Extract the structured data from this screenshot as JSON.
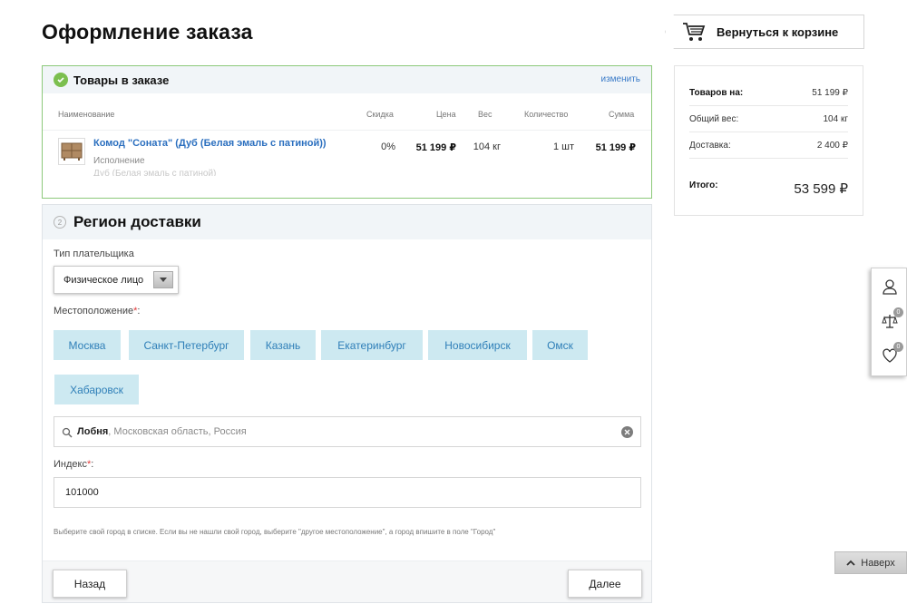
{
  "page": {
    "title": "Оформление заказа"
  },
  "header": {
    "back_to_cart_label": "Вернуться к корзине"
  },
  "goods": {
    "title": "Товары в заказе",
    "change_link": "изменить",
    "columns": {
      "name": "Наименование",
      "discount": "Скидка",
      "price": "Цена",
      "weight": "Вес",
      "quantity": "Количество",
      "sum": "Сумма"
    },
    "items": [
      {
        "name": "Комод \"Соната\" (Дуб (Белая эмаль с патиной))",
        "option_label": "Исполнение",
        "option_value": "Дуб (Белая эмаль с патиной)",
        "discount": "0%",
        "price": "51 199 ₽",
        "weight": "104 кг",
        "quantity": "1 шт",
        "sum": "51 199 ₽"
      }
    ]
  },
  "region": {
    "step": "2",
    "title": "Регион доставки",
    "payer_type_label": "Тип плательщика",
    "payer_type_value": "Физическое лицо",
    "location_label": "Местоположение",
    "required_mark": "*",
    "label_colon": ":",
    "cities": [
      "Москва",
      "Санкт-Петербург",
      "Казань",
      "Екатеринбург",
      "Новосибирск",
      "Омск",
      "Хабаровск"
    ],
    "location_city": "Лобня",
    "location_rest": ", Московская область, Россия",
    "zip_label": "Индекс",
    "zip_value": "101000",
    "hint": "Выберите свой город в списке. Если вы не нашли свой город, выберите \"другое местоположение\", а город впишите в поле \"Город\"",
    "back_button": "Назад",
    "next_button": "Далее"
  },
  "summary": {
    "goods_label": "Товаров на:",
    "goods_value": "51 199 ₽",
    "weight_label": "Общий вес:",
    "weight_value": "104 кг",
    "delivery_label": "Доставка:",
    "delivery_value": "2 400 ₽",
    "total_label": "Итого:",
    "total_value": "53 599 ₽"
  },
  "side_tools": {
    "compare_count": "0",
    "favorites_count": "0"
  },
  "to_top": {
    "label": "Наверх"
  },
  "colors": {
    "accent": "#2b6fbf",
    "success": "#7cbf4f",
    "city_bg": "#cde9f1",
    "required": "#e23a3a"
  },
  "icons": [
    "cart-icon",
    "check-icon",
    "chevron-down-icon",
    "search-icon",
    "clear-icon",
    "user-icon",
    "scales-icon",
    "heart-icon",
    "chevron-up-icon"
  ]
}
